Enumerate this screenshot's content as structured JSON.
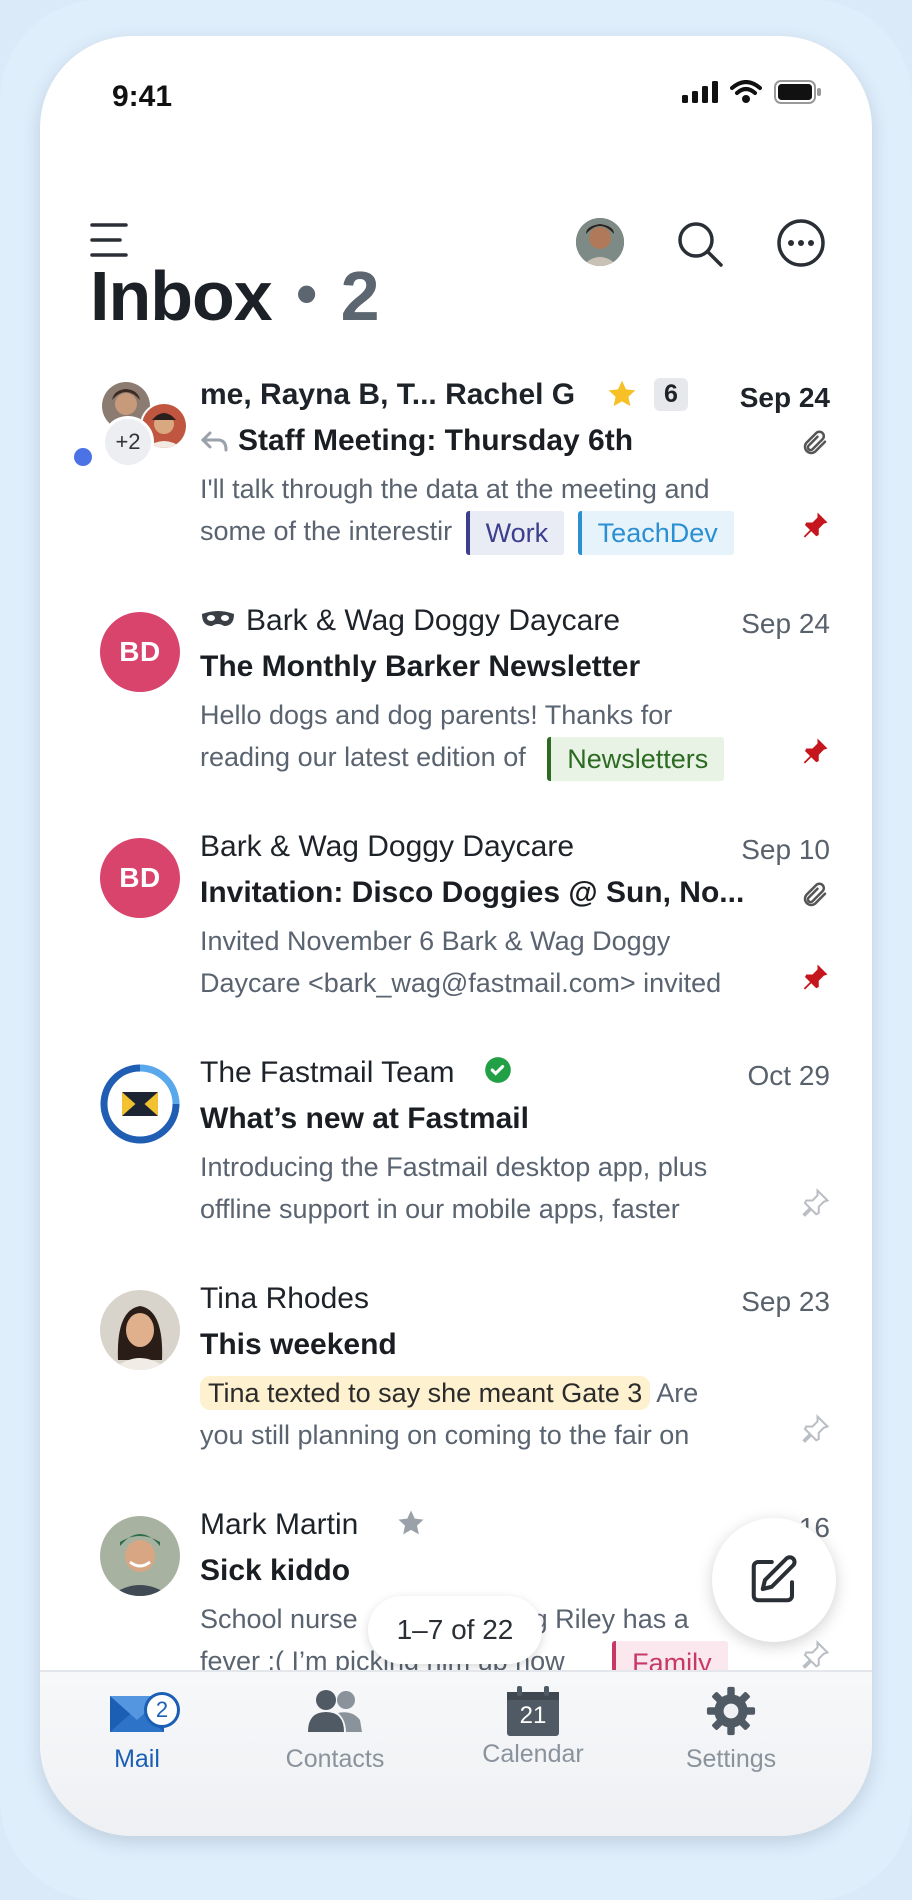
{
  "status": {
    "time": "9:41"
  },
  "header": {
    "title": "Inbox",
    "unread_count": "2"
  },
  "emails": [
    {
      "from": "me, Rayna B, T... Rachel G",
      "thread_count": "6",
      "date": "Sep 24",
      "subject": "Staff Meeting: Thursday 6th",
      "preview1": "I'll talk through the data at the meeting and",
      "preview2": "some of the interestir",
      "tags": [
        "Work",
        "TeachDev"
      ],
      "avatar_extra": "+2"
    },
    {
      "from": "Bark & Wag Doggy Daycare",
      "date": "Sep 24",
      "subject": "The Monthly Barker Newsletter",
      "preview1": "Hello dogs and dog parents! Thanks for",
      "preview2": "reading our latest edition of",
      "tags": [
        "Newsletters"
      ],
      "avatar_initials": "BD"
    },
    {
      "from": "Bark & Wag Doggy Daycare",
      "date": "Sep 10",
      "subject": "Invitation: Disco Doggies @ Sun, No...",
      "preview1": "Invited November 6 Bark & Wag Doggy",
      "preview2": "Daycare <bark_wag@fastmail.com> invited",
      "avatar_initials": "BD"
    },
    {
      "from": "The Fastmail Team",
      "date": "Oct 29",
      "subject": "What’s new at Fastmail",
      "preview1": "Introducing the Fastmail desktop app, plus",
      "preview2": "offline support in our mobile apps, faster"
    },
    {
      "from": "Tina Rhodes",
      "date": "Sep 23",
      "subject": "This weekend",
      "highlight": "Tina texted to say she meant Gate 3",
      "preview1_rest": "Are",
      "preview2": "you still planning on coming to the fair on"
    },
    {
      "from": "Mark Martin",
      "date": "16",
      "subject": "Sick kiddo",
      "preview1a": "School nurse",
      "preview1b": "g Riley has a",
      "preview2": "fever :( I’m picking him up now",
      "tags": [
        "Family"
      ]
    }
  ],
  "pager": "1–7 of 22",
  "nav": {
    "mail": "Mail",
    "mail_badge": "2",
    "contacts": "Contacts",
    "calendar": "Calendar",
    "calendar_day": "21",
    "settings": "Settings"
  },
  "colors": {
    "accent": "#1b5fb5",
    "bd_avatar": "#d9446d",
    "unread": "#4c73e6",
    "pin": "#c4161c"
  }
}
